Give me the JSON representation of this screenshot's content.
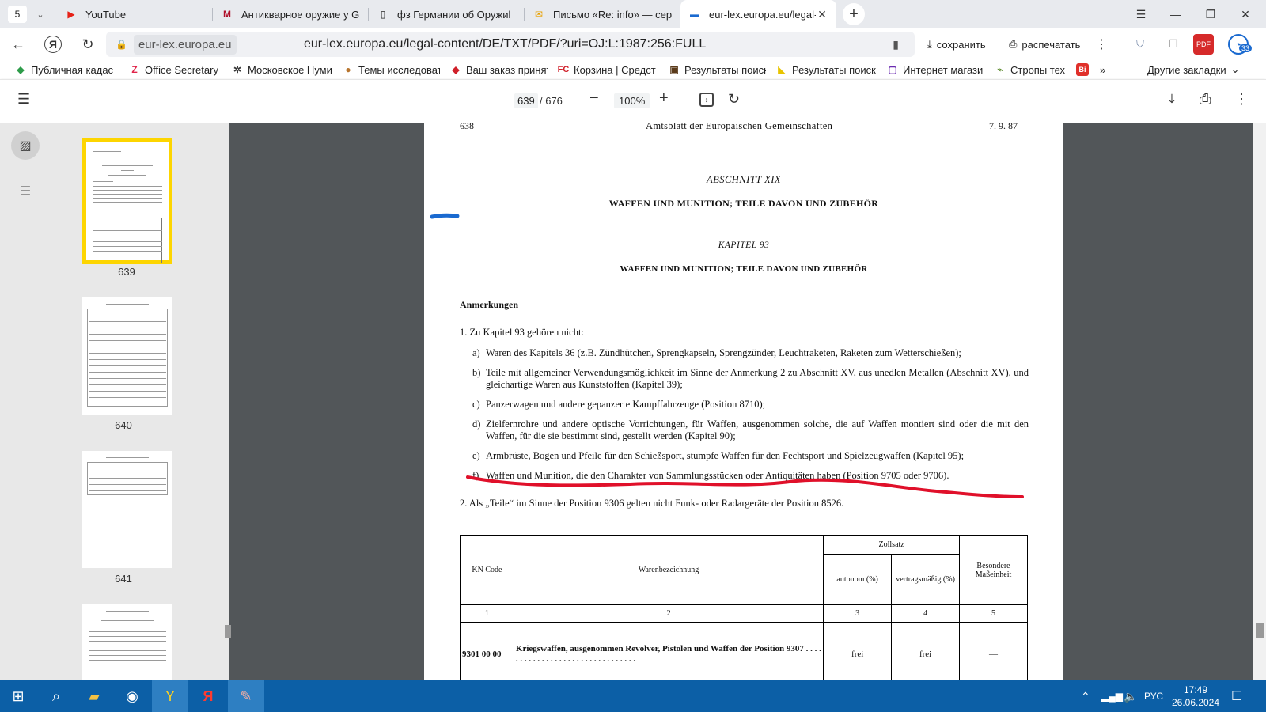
{
  "tabs": {
    "counter": "5",
    "items": [
      {
        "title": "YouTube",
        "icon": "youtube-icon",
        "active": false
      },
      {
        "title": "Антикварное оружие у G",
        "icon": "shop-icon",
        "active": false
      },
      {
        "title": "фз Германии об Оружиl",
        "icon": "document-icon",
        "active": false
      },
      {
        "title": "Письмо «Re: info» — серге",
        "icon": "mail-icon",
        "active": false
      },
      {
        "title": "eur-lex.europa.eu/legal-",
        "icon": "pdf-icon",
        "active": true
      }
    ],
    "new_tab": "+",
    "close": "✕"
  },
  "window": {
    "menu": "☰",
    "minimize": "—",
    "restore": "❐",
    "close": "✕"
  },
  "address": {
    "back": "←",
    "y_badge": "Я",
    "reload": "↻",
    "domain_pill": "eur-lex.europa.eu",
    "url": "eur-lex.europa.eu/legal-content/DE/TXT/PDF/?uri=OJ:L:1987:256:FULL",
    "save_label": "сохранить",
    "print_label": "распечатать",
    "more": "⋮",
    "ext_badge": "33"
  },
  "bookmarks": {
    "items": [
      {
        "title": "Публичная кадас",
        "icon": "map-pin-icon",
        "glyph": "◆",
        "color": "#2e9c4a"
      },
      {
        "title": "Office Secretary L",
        "icon": "z-brand-icon",
        "glyph": "Z",
        "color": "#e0254a"
      },
      {
        "title": "Московское Нуми",
        "icon": "tree-icon",
        "glyph": "✲",
        "color": "#3a3a3a"
      },
      {
        "title": "Темы исследоват",
        "icon": "cookie-icon",
        "glyph": "●",
        "color": "#b8752e"
      },
      {
        "title": "Ваш заказ принят",
        "icon": "diamond-icon",
        "glyph": "◆",
        "color": "#d0202a"
      },
      {
        "title": "Корзина | Средст",
        "icon": "fc-brand-icon",
        "glyph": "FC",
        "color": "#d0202a"
      },
      {
        "title": "Результаты поиск",
        "icon": "robot-icon",
        "glyph": "▣",
        "color": "#5a3a1a"
      },
      {
        "title": "Результаты поиск",
        "icon": "stripe-icon",
        "glyph": "◣",
        "color": "#e8c400"
      },
      {
        "title": "Интернет магазин",
        "icon": "square-icon",
        "glyph": "▢",
        "color": "#6a2ab0"
      },
      {
        "title": "Стропы тех",
        "icon": "leaf-icon",
        "glyph": "⌁",
        "color": "#5a8a2a"
      },
      {
        "title": "",
        "icon": "vi-brand-icon",
        "glyph": "Bi",
        "color": "#e0302a"
      }
    ],
    "overflow": "»",
    "other_label": "Другие закладки",
    "other_chevron": "⌄"
  },
  "pdf_toolbar": {
    "current_page": "639",
    "total_pages": "/ 676",
    "zoom": "100%",
    "zoom_out": "−",
    "zoom_in": "+"
  },
  "sidebar": {
    "thumbnails": [
      {
        "label": "639"
      },
      {
        "label": "640"
      },
      {
        "label": "641"
      }
    ]
  },
  "document": {
    "page_number": "638",
    "journal": "Amtsblatt der Europäischen Gemeinschaften",
    "date": "7. 9. 87",
    "section": "ABSCHNITT XIX",
    "section_title": "WAFFEN UND MUNITION; TEILE DAVON UND ZUBEHÖR",
    "chapter": "KAPITEL 93",
    "chapter_title": "WAFFEN UND MUNITION; TEILE DAVON UND ZUBEHÖR",
    "notes_heading": "Anmerkungen",
    "note1": "1.  Zu Kapitel 93 gehören nicht:",
    "items": [
      {
        "label": "a)",
        "text": "Waren des Kapitels 36 (z.B. Zündhütchen, Sprengkapseln, Sprengzünder, Leuchtraketen, Raketen zum Wetterschießen);"
      },
      {
        "label": "b)",
        "text": "Teile mit allgemeiner Verwendungsmöglichkeit im Sinne der Anmerkung 2 zu Abschnitt XV, aus unedlen Metallen (Abschnitt XV), und gleichartige Waren aus Kunststoffen (Kapitel 39);"
      },
      {
        "label": "c)",
        "text": "Panzerwagen und andere gepanzerte Kampffahrzeuge (Position 8710);"
      },
      {
        "label": "d)",
        "text": "Zielfernrohre und andere optische Vorrichtungen, für Waffen, ausgenommen solche, die auf Waffen montiert sind oder die mit den Waffen, für die sie bestimmt sind, gestellt werden (Kapitel 90);"
      },
      {
        "label": "e)",
        "text": "Armbrüste, Bogen und Pfeile für den Schießsport, stumpfe Waffen für den Fechtsport und Spielzeugwaffen (Kapitel 95);"
      },
      {
        "label": "f)",
        "text": "Waffen und Munition, die den Charakter von Sammlungsstücken oder Antiquitäten haben (Position 9705 oder 9706)."
      }
    ],
    "note2": "2.  Als „Teile“ im Sinne der Position 9306 gelten nicht Funk- oder Radargeräte der Position 8526.",
    "table": {
      "h_kn": "KN Code",
      "h_desc": "Warenbezeichnung",
      "h_zollsatz": "Zollsatz",
      "h_autonom": "autonom (%)",
      "h_vertrag": "vertragsmäßig (%)",
      "h_besondere": "Besondere Maßeinheit",
      "col_numbers": [
        "1",
        "2",
        "3",
        "4",
        "5"
      ],
      "rows": [
        {
          "code": "9301 00 00",
          "desc": "Kriegswaffen, ausgenommen Revolver, Pistolen und Waffen der Position 9307 . . . . . . . . . . . . . . . . . . . . . . . . . . . . . . . .",
          "autonom": "frei",
          "vertrag": "frei",
          "unit": "—"
        }
      ]
    }
  },
  "taskbar": {
    "language": "РУС",
    "time": "17:49",
    "date": "26.06.2024"
  },
  "colors": {
    "highlight_border": "#fdd500",
    "annotation_red": "#e0102a",
    "annotation_blue": "#1a6ad0",
    "taskbar": "#0c5fa6"
  }
}
